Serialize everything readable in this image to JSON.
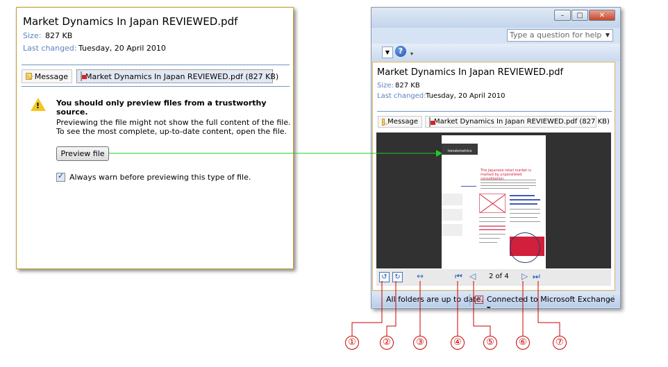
{
  "attachment": {
    "title": "Market Dynamics In Japan REVIEWED.pdf",
    "size_label": "Size:",
    "size_value": "827 KB",
    "changed_label": "Last changed:",
    "changed_value": "Tuesday, 20 April 2010"
  },
  "tabs": {
    "message_label": "Message",
    "attachment_label": "Market Dynamics In Japan REVIEWED.pdf (827 KB)"
  },
  "warning": {
    "title": "You should only preview files from a trustworthy source.",
    "line1": "Previewing the file might not show the full content of the file.",
    "line2": "To see the most complete, up-to-date content, open the file.",
    "preview_button": "Preview file",
    "checkbox_label": "Always warn before previewing this type of file.",
    "checkbox_checked": true
  },
  "window": {
    "question_placeholder": "Type a question for help",
    "help_glyph": "?",
    "close_glyph": "✕",
    "maximize_glyph": "□",
    "minimize_glyph": "–"
  },
  "preview_doc": {
    "logo_text": "trendxmetrics",
    "headline": "The Japanese retail market is marked by unparalleled consolidation."
  },
  "viewer": {
    "page_count": "2 of 4"
  },
  "status": {
    "folders": "All folders are up to date.",
    "exchange": "Connected to Microsoft Exchange"
  },
  "callouts": [
    "①",
    "②",
    "③",
    "④",
    "⑤",
    "⑥",
    "⑦"
  ],
  "colors": {
    "accent_border": "#c89a2a",
    "meta_label": "#5b82c3",
    "callout_red": "#cc0000",
    "arrow_green": "#22cc22"
  }
}
